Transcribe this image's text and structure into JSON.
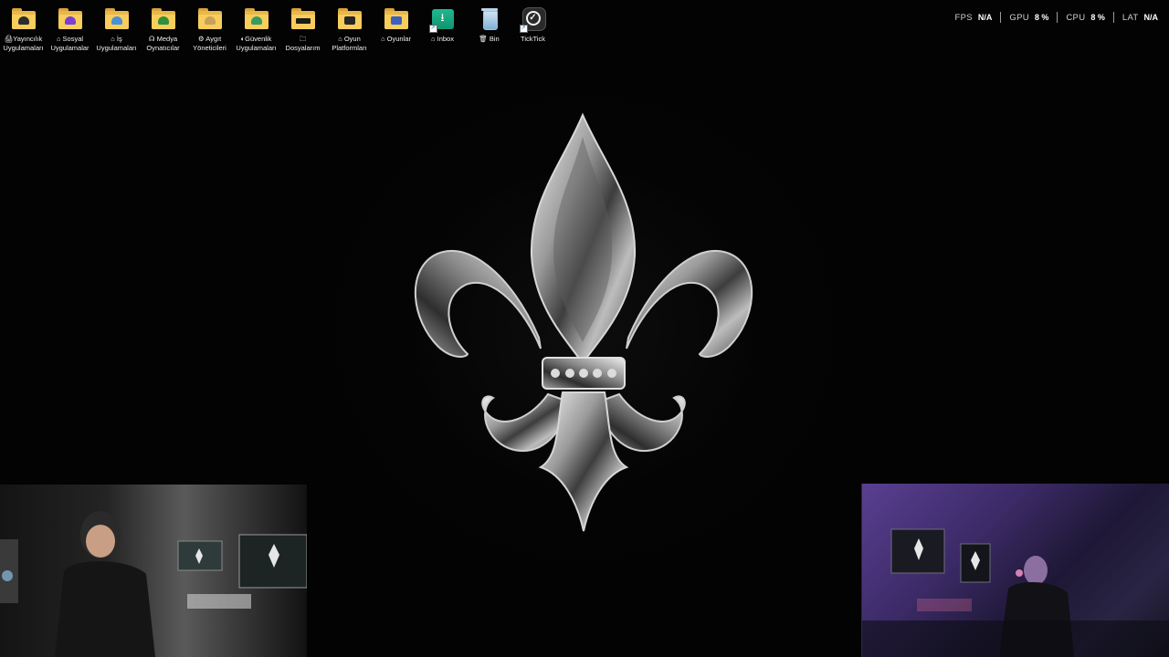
{
  "desktop": {
    "icons": [
      {
        "name": "yayincilik",
        "label": "🖨Yayıncılık\nUygulamaları",
        "icon": "folder-headset-icon",
        "badge_color": "#2d2d2d"
      },
      {
        "name": "sosyal",
        "label": "⌂ Sosyal\nUygulamalar",
        "icon": "folder-social-icon",
        "badge_color": "#7a3fd1"
      },
      {
        "name": "is",
        "label": "⌂ İş\nUygulamaları",
        "icon": "folder-work-icon",
        "badge_color": "#4b8fd6"
      },
      {
        "name": "medya",
        "label": "☊ Medya\nOynatıcılar",
        "icon": "folder-media-icon",
        "badge_color": "#2f8f3a"
      },
      {
        "name": "aygit",
        "label": "⚙ Aygıt\nYöneticileri",
        "icon": "folder-device-icon",
        "badge_color": "#c9a15a"
      },
      {
        "name": "guvenlik",
        "label": "◐Güvenlik\nUygulamaları",
        "icon": "folder-security-icon",
        "badge_color": "#3a9a5c"
      },
      {
        "name": "dosyalarim",
        "label": "🗀\nDosyalarım",
        "icon": "folder-files-icon",
        "badge_color": "#1b1b1b"
      },
      {
        "name": "oyun-platformlari",
        "label": "⌂ Oyun\nPlatformları",
        "icon": "folder-game-platform-icon",
        "badge_color": "#262626"
      },
      {
        "name": "oyunlar",
        "label": "⌂ Oyunlar",
        "icon": "folder-games-icon",
        "badge_color": "#3d5fbf"
      },
      {
        "name": "inbox",
        "label": "⌂ Inbox",
        "icon": "inbox-download-icon",
        "badge_color": "#1fb88f"
      },
      {
        "name": "bin",
        "label": "🗑 Bin",
        "icon": "recycle-bin-icon",
        "badge_color": "#9cc2df"
      },
      {
        "name": "ticktick",
        "label": "TickTick",
        "icon": "ticktick-icon",
        "badge_color": "#2a2a2a"
      }
    ]
  },
  "stats": {
    "fps_label": "FPS",
    "fps_value": "N/A",
    "gpu_label": "GPU",
    "gpu_value": "8 %",
    "cpu_label": "CPU",
    "cpu_value": "8 %",
    "lat_label": "LAT",
    "lat_value": "N/A"
  },
  "wallpaper": {
    "subject": "silver fleur-de-lis",
    "background": "#030303"
  }
}
